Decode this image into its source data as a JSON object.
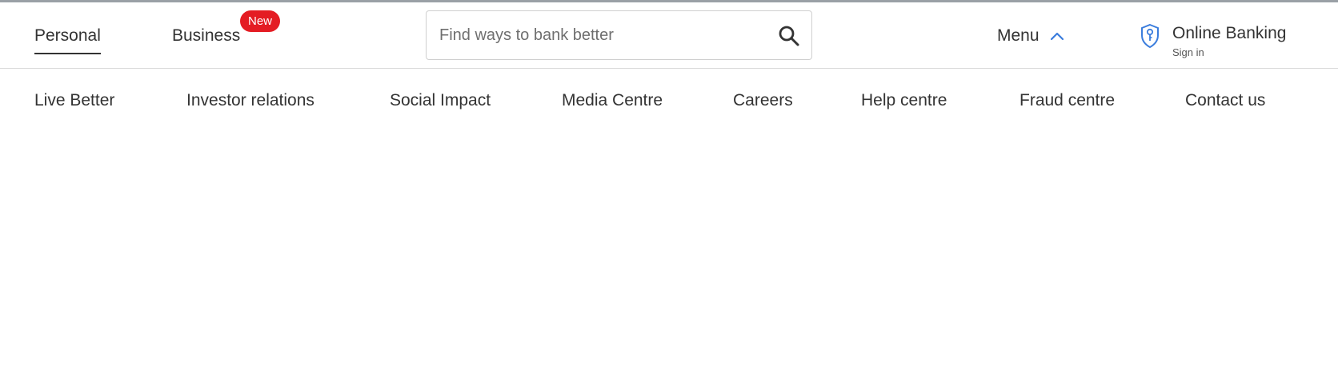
{
  "segments": {
    "personal": "Personal",
    "business": "Business",
    "new_badge": "New"
  },
  "search": {
    "placeholder": "Find ways to bank better",
    "icon": "search-icon"
  },
  "menu": {
    "label": "Menu",
    "icon": "chevron-up-icon"
  },
  "online_banking": {
    "title": "Online Banking",
    "subtitle": "Sign in",
    "icon": "shield-key-icon"
  },
  "subnav": [
    "Live Better",
    "Investor relations",
    "Social Impact",
    "Media Centre",
    "Careers",
    "Help centre",
    "Fraud centre",
    "Contact us"
  ],
  "colors": {
    "accent_blue": "#3b7ddd",
    "badge_red": "#e41c23",
    "text": "#333333"
  }
}
